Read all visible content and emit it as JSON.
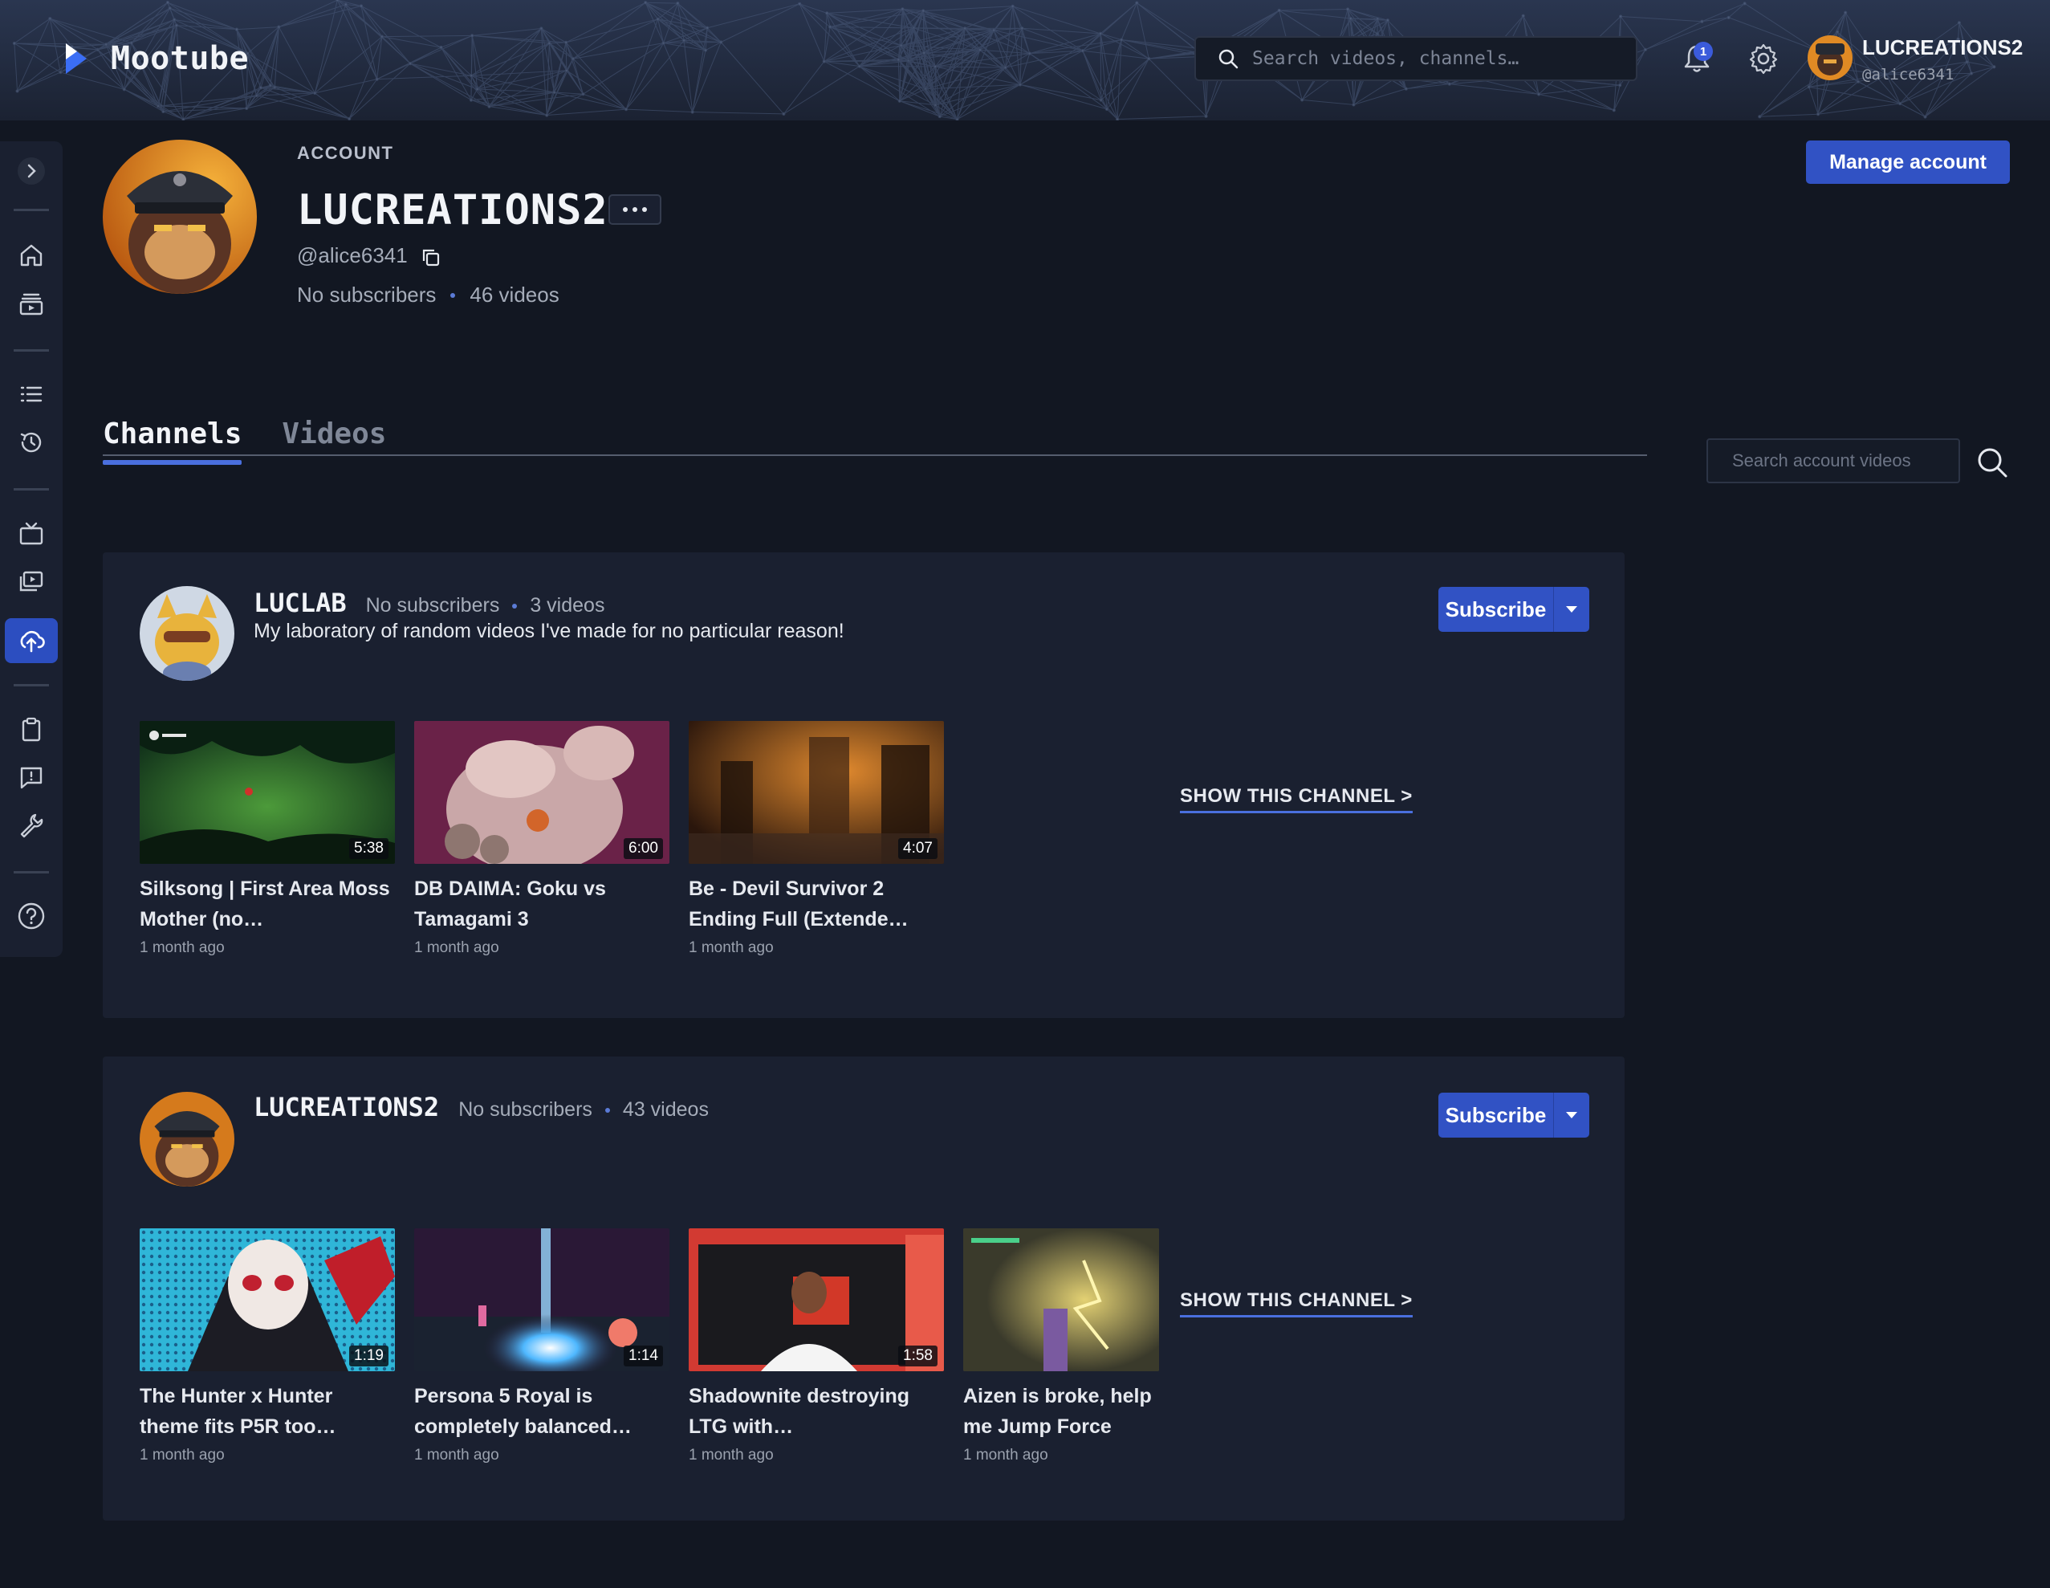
{
  "app": {
    "name": "Mootube"
  },
  "header": {
    "search_placeholder": "Search videos, channels…",
    "notification_count": "1",
    "user": {
      "name": "LUCREATIONS2",
      "handle": "@alice6341"
    }
  },
  "profile": {
    "label": "ACCOUNT",
    "name": "LUCREATIONS2",
    "handle": "@alice6341",
    "subscribers": "No subscribers",
    "videos": "46 videos",
    "manage_label": "Manage account"
  },
  "tabs": [
    {
      "label": "Channels",
      "active": true
    },
    {
      "label": "Videos",
      "active": false
    }
  ],
  "account_search_placeholder": "Search account videos",
  "channels": [
    {
      "name": "LUCLAB",
      "subscribers": "No subscribers",
      "videos": "3 videos",
      "description": "My laboratory of random videos I've made for no particular reason!",
      "subscribe_label": "Subscribe",
      "show_label": "SHOW THIS CHANNEL >",
      "items": [
        {
          "title": "Silksong | First Area Moss Mother (no…",
          "duration": "5:38",
          "date": "1 month ago"
        },
        {
          "title": "DB DAIMA: Goku vs Tamagami 3",
          "duration": "6:00",
          "date": "1 month ago"
        },
        {
          "title": "Be - Devil Survivor 2 Ending Full (Extende…",
          "duration": "4:07",
          "date": "1 month ago"
        }
      ]
    },
    {
      "name": "LUCREATIONS2",
      "subscribers": "No subscribers",
      "videos": "43 videos",
      "description": "",
      "subscribe_label": "Subscribe",
      "show_label": "SHOW THIS CHANNEL >",
      "items": [
        {
          "title": "The Hunter x Hunter theme fits P5R too…",
          "duration": "1:19",
          "date": "1 month ago"
        },
        {
          "title": "Persona 5 Royal is completely balanced…",
          "duration": "1:14",
          "date": "1 month ago"
        },
        {
          "title": "Shadownite destroying LTG with…",
          "duration": "1:58",
          "date": "1 month ago"
        },
        {
          "title": "Aizen is broke, help me Jump Force",
          "duration": "",
          "date": "1 month ago"
        }
      ]
    }
  ],
  "colors": {
    "accent": "#3152c4",
    "background": "#121722",
    "panel": "#1a2030"
  },
  "icons": {
    "sidebar": [
      "chevron-right-icon",
      "home-icon",
      "subscriptions-icon",
      "list-icon",
      "history-icon",
      "tv-icon",
      "library-icon",
      "upload-icon",
      "clipboard-icon",
      "feedback-icon",
      "wrench-icon",
      "help-icon"
    ]
  }
}
